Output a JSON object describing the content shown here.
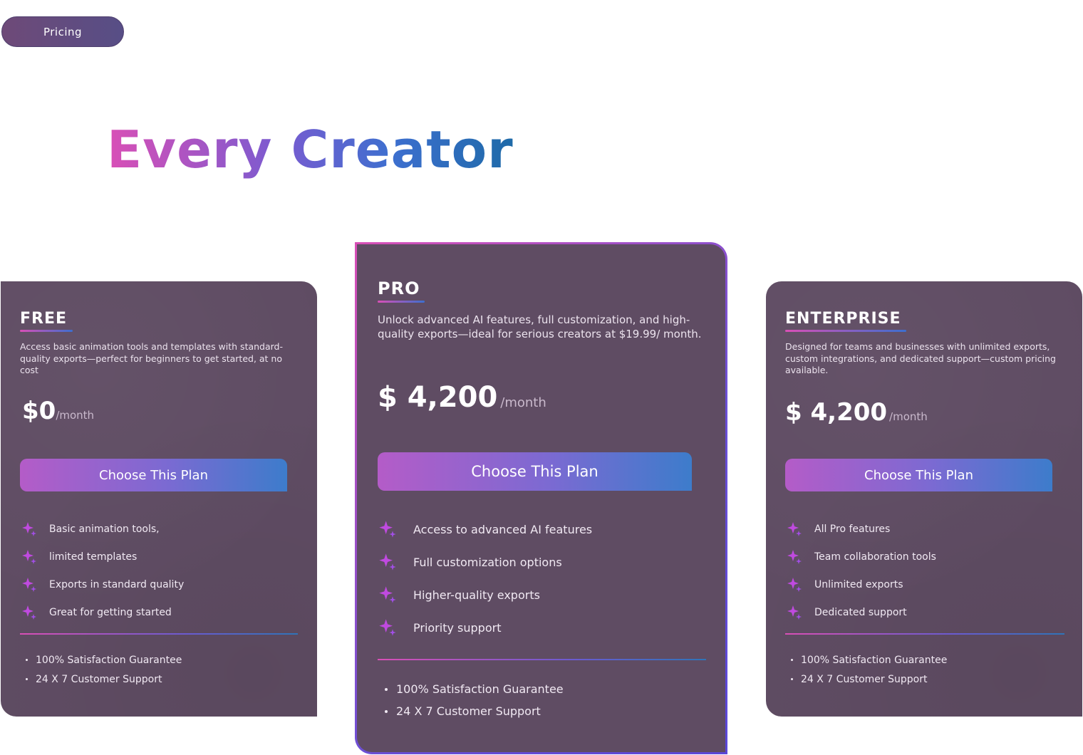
{
  "badge": {
    "label": "Pricing"
  },
  "hero": {
    "title": "Every Creator"
  },
  "plans": [
    {
      "name": "FREE",
      "description": "Access basic animation tools and templates with standard-quality exports—perfect for beginners to get started, at no cost",
      "price": "$0",
      "period": "/month",
      "cta": "Choose This Plan",
      "features": [
        "Basic animation tools,",
        "limited templates",
        "Exports in standard quality",
        "Great for getting started"
      ],
      "guarantees": [
        "100% Satisfaction Guarantee",
        "24 X 7 Customer Support"
      ]
    },
    {
      "name": "PRO",
      "description": "Unlock advanced AI features, full customization, and high-quality exports—ideal for serious creators at $19.99/ month.",
      "price": "$ 4,200",
      "period": "/month",
      "cta": "Choose This Plan",
      "features": [
        "Access to advanced AI features",
        "Full customization options",
        "Higher-quality exports",
        "Priority support"
      ],
      "guarantees": [
        "100% Satisfaction Guarantee",
        "24 X 7 Customer Support"
      ]
    },
    {
      "name": "ENTERPRISE",
      "description": "Designed for teams and businesses with unlimited exports, custom integrations, and dedicated support—custom pricing available.",
      "price": "$ 4,200",
      "period": "/month",
      "cta": "Choose This Plan",
      "features": [
        "All Pro features",
        "Team collaboration tools",
        "Unlimited exports",
        "Dedicated support"
      ],
      "guarantees": [
        "100% Satisfaction Guarantee",
        "24 X 7 Customer Support"
      ]
    }
  ],
  "colors": {
    "card_bg": "#5f4c63",
    "accent_pink": "#d94fb6",
    "accent_blue": "#3d6fcf"
  },
  "icons": {
    "feature": "sparkle-icon",
    "bullet": "bullet-dot"
  }
}
